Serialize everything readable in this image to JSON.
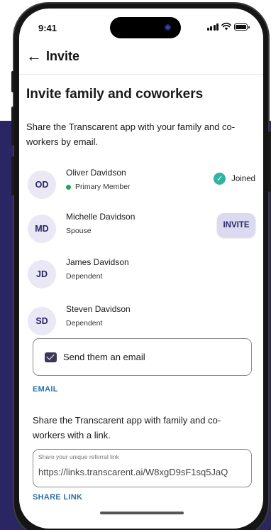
{
  "status_bar": {
    "time": "9:41"
  },
  "header": {
    "back_icon": "arrow-left-icon",
    "title": "Invite"
  },
  "page": {
    "title": "Invite family and coworkers",
    "intro": "Share the Transcarent app with your family and co-workers by email."
  },
  "members": [
    {
      "initials": "OD",
      "name": "Oliver Davidson",
      "role": "Primary Member",
      "status": "Joined"
    },
    {
      "initials": "MD",
      "name": "Michelle Davidson",
      "role": "Spouse",
      "action": "INVITE"
    },
    {
      "initials": "JD",
      "name": "James Davidson",
      "role": "Dependent"
    },
    {
      "initials": "SD",
      "name": "Steven Davidson",
      "role": "Dependent"
    }
  ],
  "email": {
    "button_text": "Send them an email",
    "link_label": "EMAIL"
  },
  "share": {
    "text": "Share the Transcarent app with family and co-workers with a link.",
    "field_label": "Share your unique referral link",
    "field_value": "https://links.transcarent.ai/W8xgD9sF1sq5JaQ",
    "link_label": "SHARE LINK"
  },
  "colors": {
    "background_panel": "#2a2563",
    "avatar_bg": "#e9e8f4",
    "avatar_text": "#2b2766",
    "invite_button_bg": "#dcdaf0",
    "link_blue": "#2d6fa5",
    "joined_check": "#2fb3a3",
    "primary_dot": "#1fa855"
  }
}
